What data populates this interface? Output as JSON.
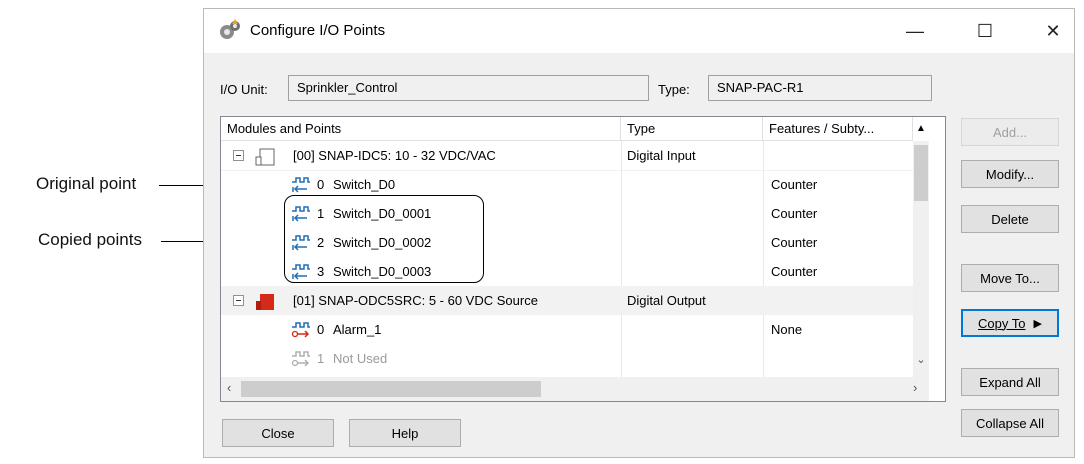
{
  "callouts": {
    "original": "Original point",
    "copied": "Copied points"
  },
  "window": {
    "title": "Configure I/O Points",
    "minimize_glyph": "—",
    "maximize_glyph": "☐",
    "close_glyph": "✕"
  },
  "io_unit": {
    "label": "I/O Unit:",
    "value": "Sprinkler_Control"
  },
  "type_field": {
    "label": "Type:",
    "value": "SNAP-PAC-R1"
  },
  "grid": {
    "columns": [
      "Modules and Points",
      "Type",
      "Features / Subty..."
    ],
    "modules": [
      {
        "label": "[00] SNAP-IDC5: 10 - 32 VDC/VAC",
        "type": "Digital Input",
        "color": "#ffffff"
      },
      {
        "label": "[01] SNAP-ODC5SRC: 5 - 60 VDC Source",
        "type": "Digital Output",
        "color": "#d42a1a"
      }
    ],
    "points": [
      {
        "num": "0",
        "name": "Switch_D0",
        "feature": "Counter"
      },
      {
        "num": "1",
        "name": "Switch_D0_0001",
        "feature": "Counter"
      },
      {
        "num": "2",
        "name": "Switch_D0_0002",
        "feature": "Counter"
      },
      {
        "num": "3",
        "name": "Switch_D0_0003",
        "feature": "Counter"
      },
      {
        "num": "0",
        "name": "Alarm_1",
        "feature": "None"
      },
      {
        "num": "1",
        "name": "Not Used",
        "feature": ""
      }
    ]
  },
  "buttons": {
    "add": "Add...",
    "modify": "Modify...",
    "delete": "Delete",
    "move_to": "Move To...",
    "copy_to": "Copy To",
    "copy_to_arrow": "▶",
    "expand_all": "Expand All",
    "collapse_all": "Collapse All",
    "close": "Close",
    "help": "Help"
  },
  "colors": {
    "accent": "#0078d7",
    "input_icon": "#1e6fb5",
    "output_icon": "#d42a1a"
  }
}
